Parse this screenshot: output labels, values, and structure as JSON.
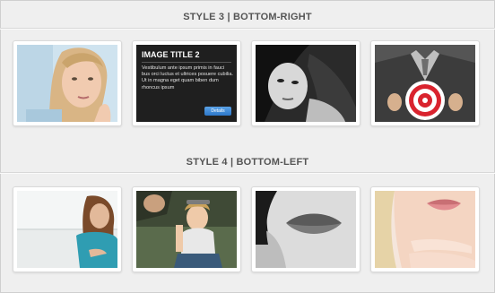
{
  "sections": [
    {
      "title": "STYLE 3 | BOTTOM-RIGHT",
      "thumbnails": [
        {
          "subject": "woman-thinking-photo"
        },
        {
          "subject": "caption-overlay",
          "caption": {
            "title": "IMAGE TITLE 2",
            "text": "Vestibulum ante ipsum primis in fauci bus orci luctus et ultrices posuere cubilia. Ut in magna eget quam biben dum rhoncus ipsum",
            "button": "Details"
          }
        },
        {
          "subject": "woman-black-white-photo"
        },
        {
          "subject": "businessman-target-photo"
        }
      ]
    },
    {
      "title": "STYLE 4 | BOTTOM-LEFT",
      "thumbnails": [
        {
          "subject": "woman-teal-shirt-photo"
        },
        {
          "subject": "girl-hand-reaching-photo"
        },
        {
          "subject": "lips-bw-closeup-photo"
        },
        {
          "subject": "woman-lips-hand-photo"
        }
      ]
    }
  ],
  "colors": {
    "background": "#efefef",
    "title_text": "#555555",
    "button": "#3a86d6",
    "target_red": "#d9232e"
  }
}
